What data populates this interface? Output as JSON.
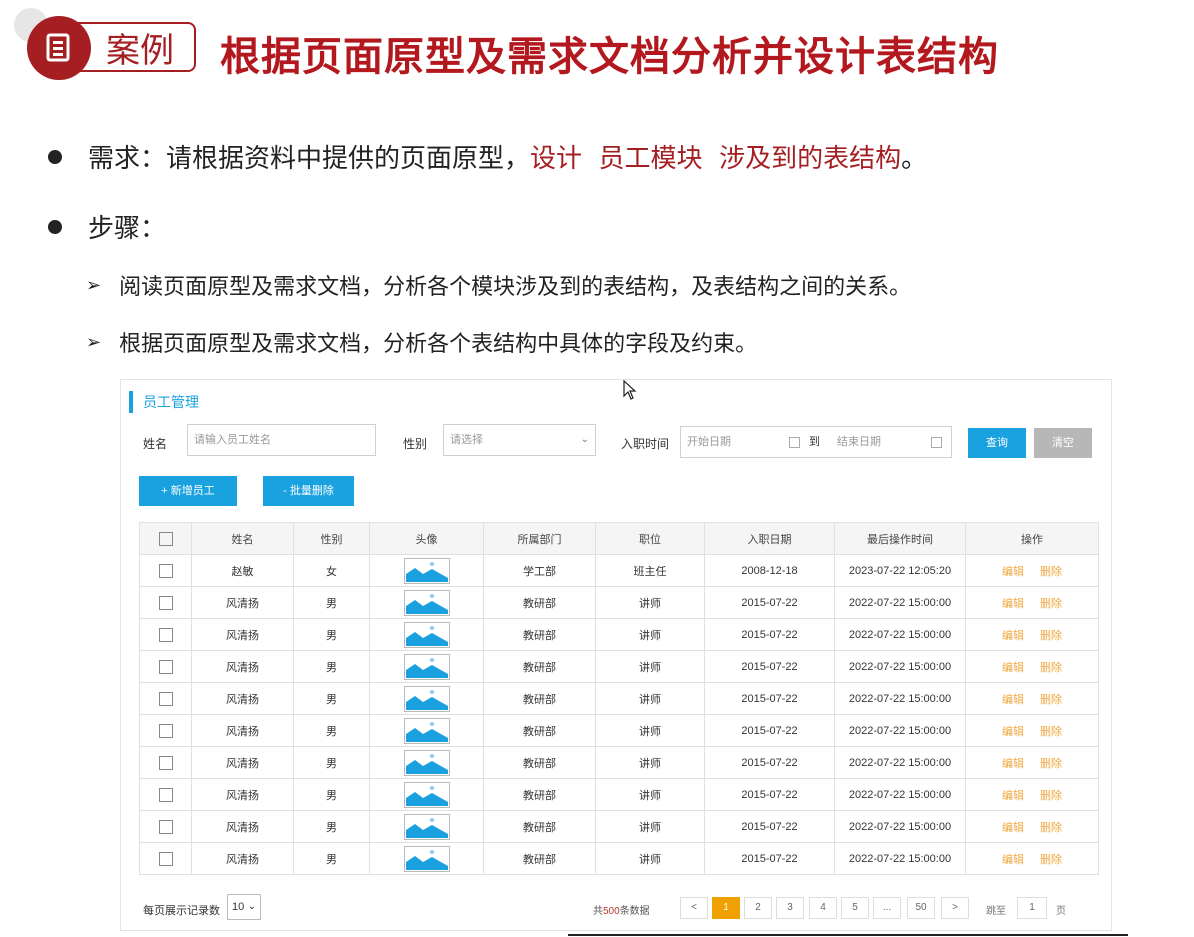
{
  "slide": {
    "tag": "案例",
    "title": "根据页面原型及需求文档分析并设计表结构",
    "bullet1": {
      "prefix": "需求：请根据资料中提供的页面原型，",
      "highlight": "设计  员工模块  涉及到的表结构",
      "suffix": "。"
    },
    "bullet2": "步骤：",
    "step1": "阅读页面原型及需求文档，分析各个模块涉及到的表结构，及表结构之间的关系。",
    "step2": "根据页面原型及需求文档，分析各个表结构中具体的字段及约束。"
  },
  "app": {
    "title": "员工管理",
    "search": {
      "name_label": "姓名",
      "name_placeholder": "请输入员工姓名",
      "gender_label": "性别",
      "gender_placeholder": "请选择",
      "date_label": "入职时间",
      "start_placeholder": "开始日期",
      "to_label": "到",
      "end_placeholder": "结束日期",
      "query_button": "查询",
      "clear_button": "清空"
    },
    "toolbar": {
      "add_button": "+ 新增员工",
      "batch_delete_button": "- 批量删除"
    },
    "table": {
      "headers": [
        "姓名",
        "性别",
        "头像",
        "所属部门",
        "职位",
        "入职日期",
        "最后操作时间",
        "操作"
      ],
      "edit_label": "编辑",
      "delete_label": "删除",
      "rows": [
        {
          "name": "赵敏",
          "gender": "女",
          "dept": "学工部",
          "job": "班主任",
          "entry": "2008-12-18",
          "updated": "2023-07-22 12:05:20"
        },
        {
          "name": "风清扬",
          "gender": "男",
          "dept": "教研部",
          "job": "讲师",
          "entry": "2015-07-22",
          "updated": "2022-07-22 15:00:00"
        },
        {
          "name": "风清扬",
          "gender": "男",
          "dept": "教研部",
          "job": "讲师",
          "entry": "2015-07-22",
          "updated": "2022-07-22 15:00:00"
        },
        {
          "name": "风清扬",
          "gender": "男",
          "dept": "教研部",
          "job": "讲师",
          "entry": "2015-07-22",
          "updated": "2022-07-22 15:00:00"
        },
        {
          "name": "风清扬",
          "gender": "男",
          "dept": "教研部",
          "job": "讲师",
          "entry": "2015-07-22",
          "updated": "2022-07-22 15:00:00"
        },
        {
          "name": "风清扬",
          "gender": "男",
          "dept": "教研部",
          "job": "讲师",
          "entry": "2015-07-22",
          "updated": "2022-07-22 15:00:00"
        },
        {
          "name": "风清扬",
          "gender": "男",
          "dept": "教研部",
          "job": "讲师",
          "entry": "2015-07-22",
          "updated": "2022-07-22 15:00:00"
        },
        {
          "name": "风清扬",
          "gender": "男",
          "dept": "教研部",
          "job": "讲师",
          "entry": "2015-07-22",
          "updated": "2022-07-22 15:00:00"
        },
        {
          "name": "风清扬",
          "gender": "男",
          "dept": "教研部",
          "job": "讲师",
          "entry": "2015-07-22",
          "updated": "2022-07-22 15:00:00"
        },
        {
          "name": "风清扬",
          "gender": "男",
          "dept": "教研部",
          "job": "讲师",
          "entry": "2015-07-22",
          "updated": "2022-07-22 15:00:00"
        }
      ]
    },
    "pagination": {
      "page_size_label": "每页展示记录数",
      "page_size_value": "10",
      "total_prefix": "共",
      "total_count": "500",
      "total_suffix": "条数据",
      "prev": "<",
      "pages": [
        "1",
        "2",
        "3",
        "4",
        "5",
        "...",
        "50"
      ],
      "current_page": "1",
      "next": ">",
      "jump_label": "跳至",
      "jump_value": "1",
      "page_unit": "页"
    }
  },
  "colors": {
    "brand_red": "#a51e22",
    "accent_blue": "#1aa1e0",
    "action_orange": "#f0a640",
    "active_page": "#f0a000"
  }
}
